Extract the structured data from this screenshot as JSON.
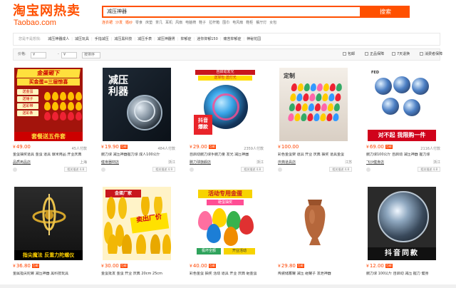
{
  "logo": {
    "cn": "淘宝网热卖",
    "en": "Taobao.com"
  },
  "search": {
    "value": "减压神器",
    "button": "搜索"
  },
  "hot_links": [
    "连衣裙",
    "沙发",
    "婚纱",
    "零食",
    "床垫",
    "茶几",
    "耳机",
    "风扇",
    "电脑椅",
    "鞋子",
    "拉杆箱",
    "围巾",
    "电风扇",
    "鞋柜",
    "餐厅灯",
    "女包"
  ],
  "related": {
    "label": "您是不是想找:",
    "items": [
      "减压神器成人",
      "减压玩具",
      "手指减压",
      "减压黑科技",
      "减压手表",
      "减压神器男",
      "抑郁症",
      "迷你抑郁150",
      "痛苦抑郁症",
      "神秘花园"
    ]
  },
  "filter": {
    "price_label": "价格:",
    "price_min": "¥",
    "price_max": "¥",
    "sort": "按排序",
    "checks": [
      "包邮",
      "正品保障",
      "7天退换",
      "消费者保障"
    ]
  },
  "products": [
    {
      "price": "49.00",
      "tag": "",
      "sold": "45人付款",
      "title": "金蛋抽奖道具 金蛋 道具 爆米用品 开业庆典",
      "shop": "品质用品店",
      "loc": "上海",
      "match": "相关描述 4.8",
      "img": {
        "banner": "金蛋砸下",
        "banner2": "买金蛋=三层惊喜",
        "tickets": [
          "送金蛋",
          "送锤子",
          "送彩带",
          "送彩条"
        ],
        "bottom": "套餐送五件套"
      }
    },
    {
      "price": "19.90",
      "tag": "包邮",
      "sold": "484人付款",
      "title": "腕力球 减压神器握力球 成人100公斤",
      "shop": "健身器材店",
      "loc": "浙江",
      "match": "相关描述 4.9",
      "img": {
        "title": "减压\n利器"
      }
    },
    {
      "price": "29.00",
      "tag": "包邮",
      "sold": "2359人付款",
      "title": "自启动腕力球手腕力量 发光 减压神器",
      "shop": "腕力球旗舰店",
      "loc": "浙江",
      "match": "相关描述 4.8",
      "img": {
        "top": "自启动发光",
        "top2": "送球包 送灯光",
        "badge": "抖音\n爆款"
      }
    },
    {
      "price": "100.00",
      "tag": "",
      "sold": "",
      "title": "彩色金蛋架 道具 开业 庆典 抽奖 道具金蛋",
      "shop": "庆典道具店",
      "loc": "江苏",
      "match": "相关描述 4.8",
      "img": {
        "title": "定制"
      }
    },
    {
      "price": "69.00",
      "tag": "包邮",
      "sold": "2116人付款",
      "title": "腕力球100公斤 自启动 减压神器 握力球",
      "shop": "飞沙健身店",
      "loc": "浙江",
      "match": "相关描述 4.8",
      "img": {
        "logo": "FED",
        "bottom": "对不起 我限购一件"
      }
    },
    {
      "price": "36.80",
      "tag": "包邮",
      "sold": "",
      "title": "金属指尖陀螺 减压神器 黑科技玩具",
      "shop": "指尖魔法店",
      "loc": "广东",
      "match": "相关描述 4.8",
      "img": {
        "bottom": "指尖魔法 反重力陀螺仪"
      }
    },
    {
      "price": "30.00",
      "tag": "包邮",
      "sold": "",
      "title": "金蛋批发 金蛋 开业 庆典 20cm 25cm",
      "shop": "金蛋厂家",
      "loc": "浙江",
      "match": "相关描述 4.9",
      "img": {
        "top": "金蛋厂家",
        "big": "卖出厂价"
      }
    },
    {
      "price": "40.00",
      "tag": "包邮",
      "sold": "",
      "title": "彩色金蛋 抽奖 活动 道具 开业 庆典 砸金蛋",
      "shop": "金蛋专卖店",
      "loc": "浙江",
      "match": "相关描述 4.8",
      "img": {
        "top": "活动专用金蛋",
        "sub": "砸蛋抽奖",
        "bar": "极坏全额",
        "bar2": "开业活动"
      }
    },
    {
      "price": "29.80",
      "tag": "包邮",
      "sold": "",
      "title": "陶瓷储蓄罐 减压 砸罐子 发泄神器",
      "shop": "陶艺小店",
      "loc": "江西",
      "match": "相关描述 4.8",
      "img": {}
    },
    {
      "price": "12.00",
      "tag": "包邮",
      "sold": "",
      "title": "腕力球 100公斤 自启动 减压 握力 健身",
      "shop": "腕力球店",
      "loc": "浙江",
      "match": "相关描述 4.8",
      "img": {
        "bottom": "抖音同款"
      }
    }
  ],
  "colors": {
    "brand": "#ff5000",
    "price": "#ff4400"
  }
}
